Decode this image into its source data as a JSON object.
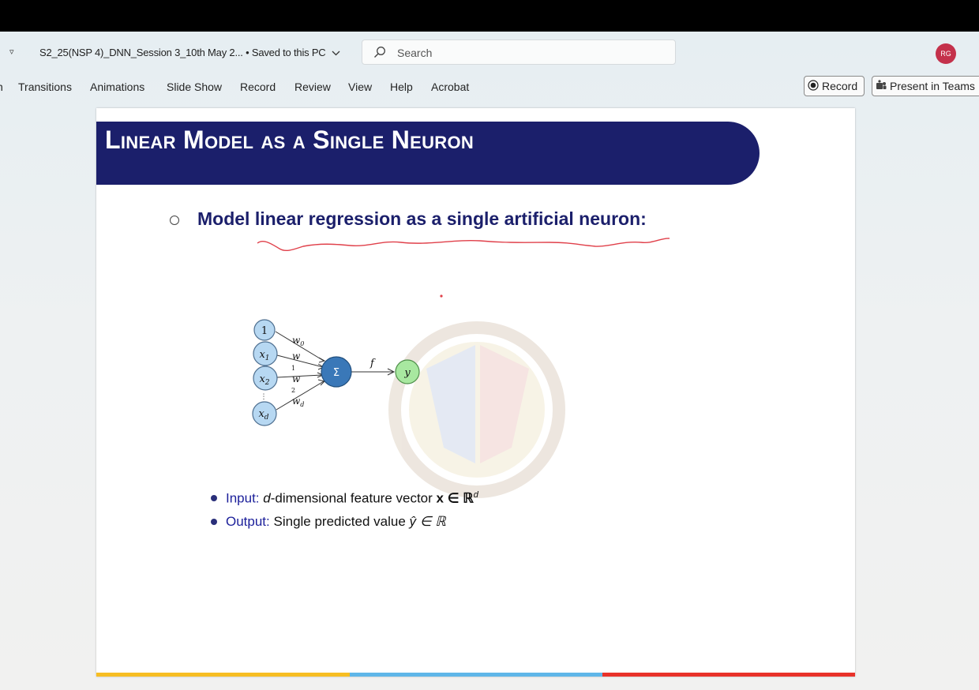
{
  "window": {
    "doc_title": "S2_25(NSP 4)_DNN_Session 3_10th May 2...",
    "save_status": "• Saved to this PC"
  },
  "search": {
    "placeholder": "Search"
  },
  "user": {
    "initials": "RG",
    "avatar_color": "#c4314b"
  },
  "ribbon": {
    "tabs": [
      "Transitions",
      "Animations",
      "Slide Show",
      "Record",
      "Review",
      "View",
      "Help",
      "Acrobat"
    ],
    "record_button": "Record",
    "present_button": "Present in Teams"
  },
  "slide": {
    "title": "Linear Model as a Single Neuron",
    "main_bullet": "Model linear regression as a single artificial neuron:",
    "diagram": {
      "inputs": [
        "1",
        "x1",
        "x2",
        "xd"
      ],
      "weights": [
        "w0",
        "w1",
        "w2",
        "wd"
      ],
      "sum_symbol": "Σ",
      "activation": "f",
      "output": "y"
    },
    "bullets": [
      {
        "label": "Input:",
        "text_italic": "d",
        "text": "-dimensional feature vector",
        "math": "x ∈ ℝ",
        "math_sup": "d"
      },
      {
        "label": "Output:",
        "text": "Single predicted value",
        "math": "ŷ ∈ ℝ"
      }
    ]
  },
  "colors": {
    "banner": "#1b1f6b",
    "accent_bar": [
      "#f7be23",
      "#5fb6e8",
      "#e8322a"
    ],
    "annotation": "#e0404a"
  }
}
